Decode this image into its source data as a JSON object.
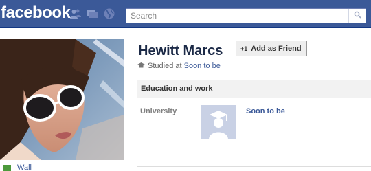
{
  "topbar": {
    "logo": "facebook",
    "brand_color": "#3b5998",
    "jewels": [
      "friend-requests-icon",
      "messages-icon",
      "notifications-globe-icon"
    ]
  },
  "search": {
    "placeholder": "Search",
    "icon": "search-icon"
  },
  "profile": {
    "name": "Hewitt Marcs",
    "add_friend_label": "Add as Friend",
    "studied_prefix": "Studied at",
    "studied_school": "Soon to be"
  },
  "sidebar": {
    "wall_label": "Wall"
  },
  "education": {
    "section_title": "Education and work",
    "row_label": "University",
    "school_name": "Soon to be"
  }
}
